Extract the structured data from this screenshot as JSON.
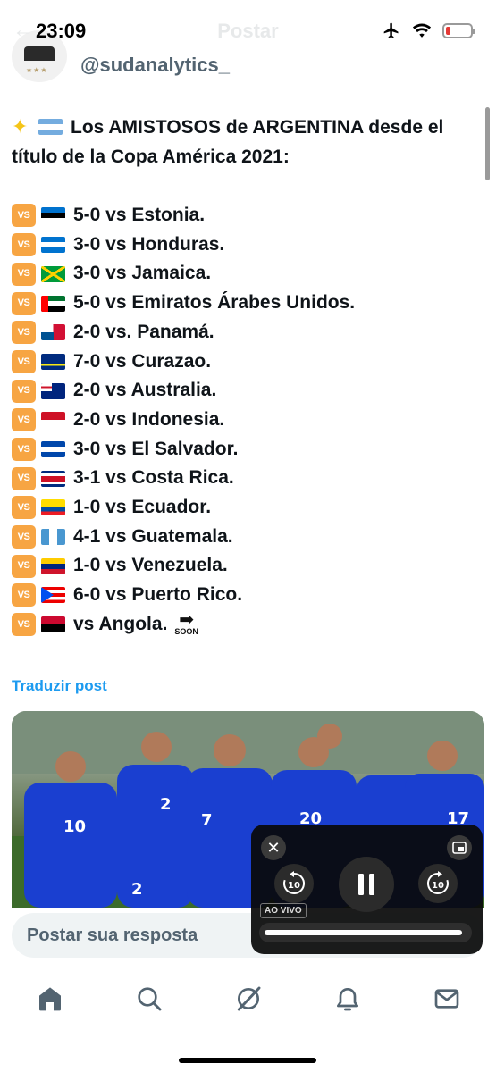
{
  "status_bar": {
    "time": "23:09",
    "battery_level": 0.12
  },
  "header": {
    "title": "Postar",
    "back_glyph": "←"
  },
  "author": {
    "handle": "@sudanalytics_",
    "avatar_stars": "★★★"
  },
  "tweet": {
    "headline": "Los AMISTOSOS de ARGENTINA desde el título de la Copa América 2021:",
    "headline_icons": [
      "sparkle-star-icon",
      "argentina-flag"
    ],
    "vs_label": "VS",
    "results": [
      {
        "flag": "estonia",
        "text": "5-0 vs Estonia."
      },
      {
        "flag": "honduras",
        "text": "3-0 vs Honduras."
      },
      {
        "flag": "jamaica",
        "text": "3-0 vs Jamaica."
      },
      {
        "flag": "uae",
        "text": "5-0 vs Emiratos Árabes Unidos."
      },
      {
        "flag": "panama",
        "text": "2-0 vs. Panamá."
      },
      {
        "flag": "curacao",
        "text": "7-0 vs Curazao."
      },
      {
        "flag": "australia",
        "text": "2-0 vs Australia."
      },
      {
        "flag": "indonesia",
        "text": "2-0 vs Indonesia."
      },
      {
        "flag": "el-salvador",
        "text": "3-0 vs El Salvador."
      },
      {
        "flag": "costa-rica",
        "text": "3-1 vs Costa Rica."
      },
      {
        "flag": "ecuador",
        "text": "1-0 vs Ecuador."
      },
      {
        "flag": "guatemala",
        "text": "4-1 vs Guatemala."
      },
      {
        "flag": "venezuela",
        "text": "1-0 vs Venezuela."
      },
      {
        "flag": "puerto-rico",
        "text": "6-0 vs Puerto Rico."
      },
      {
        "flag": "angola",
        "text": "vs Angola."
      }
    ],
    "soon_label": "SOON",
    "soon_arrow": "➡"
  },
  "translate_link": "Traduzir post",
  "player": {
    "close_glyph": "✕",
    "skip_back_label": "10",
    "skip_forward_label": "10",
    "live_label": "AO VIVO",
    "progress": 0.98
  },
  "reply": {
    "placeholder": "Postar sua resposta"
  },
  "bottom_nav": {
    "items": [
      "home-icon",
      "search-icon",
      "grok-icon",
      "notifications-icon",
      "messages-icon"
    ]
  },
  "colors": {
    "accent": "#1d9bf0",
    "vs_badge": "#f7a543"
  }
}
